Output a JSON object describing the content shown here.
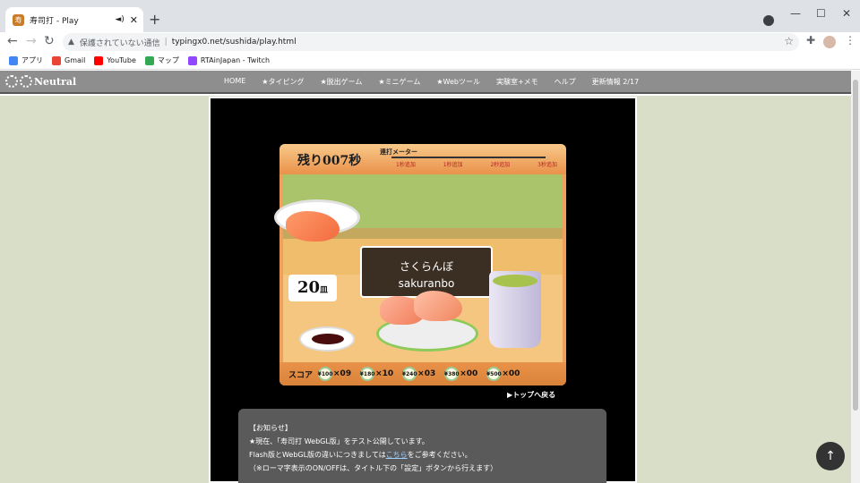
{
  "browser": {
    "tab_title": "寿司打 - Play",
    "tab_audio_icon": "speaker-icon",
    "tab_close": "✕",
    "new_tab": "+",
    "window_controls": {
      "minimize": "—",
      "maximize": "☐",
      "close": "✕"
    },
    "address": {
      "security_text": "保護されていない通信",
      "url": "typingx0.net/sushida/play.html"
    },
    "bookmarks": [
      {
        "label": "アプリ",
        "icon": "apps-grid-icon",
        "color": "#4285f4"
      },
      {
        "label": "Gmail",
        "icon": "gmail-icon",
        "color": "#ea4335"
      },
      {
        "label": "YouTube",
        "icon": "youtube-icon",
        "color": "#ff0000"
      },
      {
        "label": "マップ",
        "icon": "maps-icon",
        "color": "#34a853"
      },
      {
        "label": "RTAinJapan - Twitch",
        "icon": "twitch-icon",
        "color": "#9146ff"
      }
    ]
  },
  "site": {
    "logo": "Neutral",
    "menu": [
      "HOME",
      "★タイピング",
      "★脱出ゲーム",
      "★ミニゲーム",
      "★Webツール",
      "実験室+メモ",
      "ヘルプ",
      "更新情報 2/17"
    ]
  },
  "game": {
    "timer": "残り007秒",
    "meter_label": "連打メーター",
    "meter_ticks": [
      "1秒追加",
      "1秒追加",
      "2秒追加",
      "3秒追加"
    ],
    "word_kana": "さくらんぼ",
    "word_romaji": "sakuranbo",
    "plates_count": "20",
    "plates_unit": "皿",
    "score_label": "スコア",
    "score_items": [
      {
        "price": "¥100",
        "count": "×09"
      },
      {
        "price": "¥180",
        "count": "×10"
      },
      {
        "price": "¥240",
        "count": "×03"
      },
      {
        "price": "¥380",
        "count": "×00"
      },
      {
        "price": "¥500",
        "count": "×00"
      }
    ],
    "back_to_top": "▶トップへ戻る"
  },
  "notice": {
    "title": "【お知らせ】",
    "line1": "★現在、「寿司打 WebGL版」をテスト公開しています。",
    "line2_pre": "Flash版とWebGL版の違いにつきましては",
    "line2_link": "こちら",
    "line2_post": "をご参考ください。",
    "line3": "（※ローマ字表示のON/OFFは、タイトル下の「設定」ボタンから行えます）"
  },
  "fab": "↑"
}
